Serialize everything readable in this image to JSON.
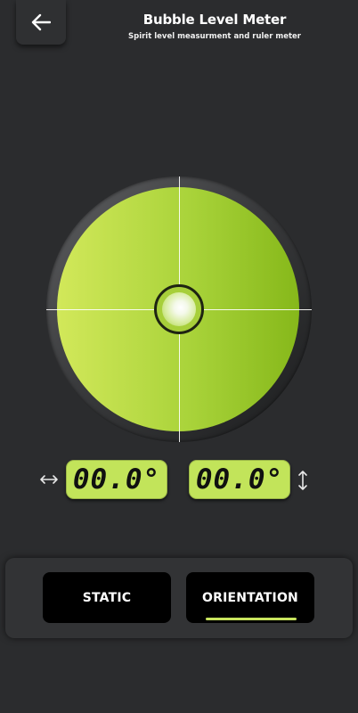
{
  "header": {
    "title": "Bubble Level Meter",
    "subtitle": "Spirit level measurment and ruler meter",
    "back_icon": "arrow-left-icon"
  },
  "colors": {
    "background": "#2b2c2e",
    "accent": "#c2e45a",
    "bubble_face": "#a9d33a"
  },
  "readouts": {
    "horizontal_value": "00.0°",
    "vertical_value": "00.0°",
    "horizontal_icon": "horizontal-arrows-icon",
    "vertical_icon": "vertical-arrows-icon"
  },
  "bubble": {
    "x_tilt": 0.0,
    "y_tilt": 0.0
  },
  "modes": {
    "static_label": "STATIC",
    "orientation_label": "ORIENTATION",
    "selected": "ORIENTATION"
  }
}
